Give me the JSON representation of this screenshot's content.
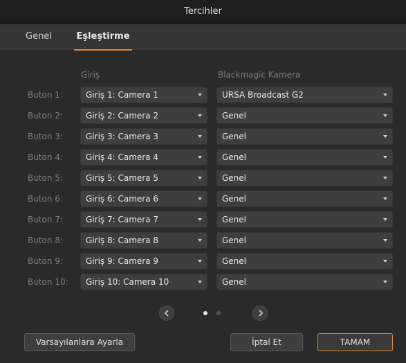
{
  "window": {
    "title": "Tercihler"
  },
  "tabs": {
    "general": "Genel",
    "mapping": "Eşleştirme"
  },
  "columns": {
    "input": "Giriş",
    "camera": "Blackmagic Kamera"
  },
  "rows": [
    {
      "label": "Buton 1:",
      "input": "Giriş 1: Camera 1",
      "camera": "URSA Broadcast G2"
    },
    {
      "label": "Buton 2:",
      "input": "Giriş 2: Camera 2",
      "camera": "Genel"
    },
    {
      "label": "Buton 3:",
      "input": "Giriş 3: Camera 3",
      "camera": "Genel"
    },
    {
      "label": "Buton 4:",
      "input": "Giriş 4: Camera 4",
      "camera": "Genel"
    },
    {
      "label": "Buton 5:",
      "input": "Giriş 5: Camera 5",
      "camera": "Genel"
    },
    {
      "label": "Buton 6:",
      "input": "Giriş 6: Camera 6",
      "camera": "Genel"
    },
    {
      "label": "Buton 7:",
      "input": "Giriş 7: Camera 7",
      "camera": "Genel"
    },
    {
      "label": "Buton 8:",
      "input": "Giriş 8: Camera 8",
      "camera": "Genel"
    },
    {
      "label": "Buton 9:",
      "input": "Giriş 9: Camera 9",
      "camera": "Genel"
    },
    {
      "label": "Buton 10:",
      "input": "Giriş 10: Camera 10",
      "camera": "Genel"
    }
  ],
  "pager": {
    "prev_icon": "chevron-left-icon",
    "next_icon": "chevron-right-icon",
    "current_page": 1,
    "total_pages": 2
  },
  "buttons": {
    "reset": "Varsayılanlara Ayarla",
    "cancel": "İptal Et",
    "ok": "TAMAM"
  },
  "colors": {
    "accent": "#e0872c",
    "background": "#2a2a2a",
    "dot_active": "#e6e6e6",
    "dot_inactive": "#555555"
  }
}
